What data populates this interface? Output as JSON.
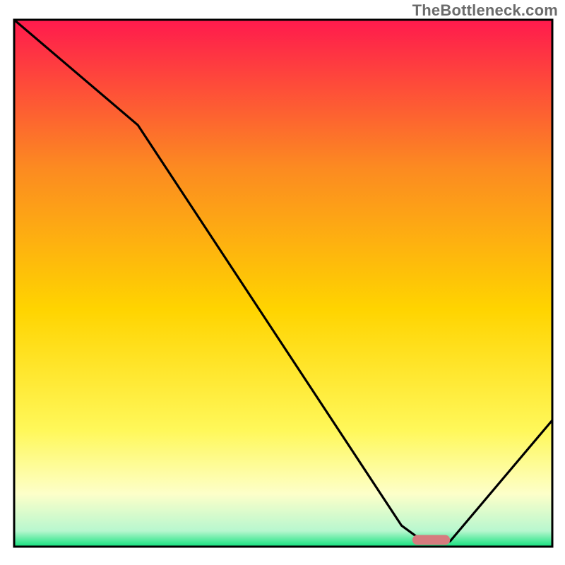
{
  "watermark": "TheBottleneck.com",
  "colors": {
    "gradient_top": "#ff1a4d",
    "gradient_mid_upper": "#fc8a21",
    "gradient_mid": "#ffd400",
    "gradient_mid_lower": "#fff85a",
    "gradient_lower": "#fdffc9",
    "gradient_green": "#12e07d",
    "curve": "#000000",
    "frame": "#000000",
    "marker": "#d67b7e"
  },
  "chart_data": {
    "type": "line",
    "title": "",
    "xlabel": "",
    "ylabel": "",
    "ylim": [
      0,
      100
    ],
    "xlim": [
      0,
      100
    ],
    "x": [
      0,
      23,
      72,
      76,
      81,
      100
    ],
    "values": [
      100,
      80,
      4,
      1,
      1,
      24
    ],
    "marker": {
      "x_start": 74,
      "x_end": 81,
      "y": 1,
      "note": "optimal-range-marker"
    },
    "notes": "V-shaped bottleneck curve. Axes have no visible tick labels in the source image; x and y are normalized 0–100 estimates from pixel positions. Gradient background runs red (bad) at top through orange/yellow to green (good) at bottom."
  }
}
